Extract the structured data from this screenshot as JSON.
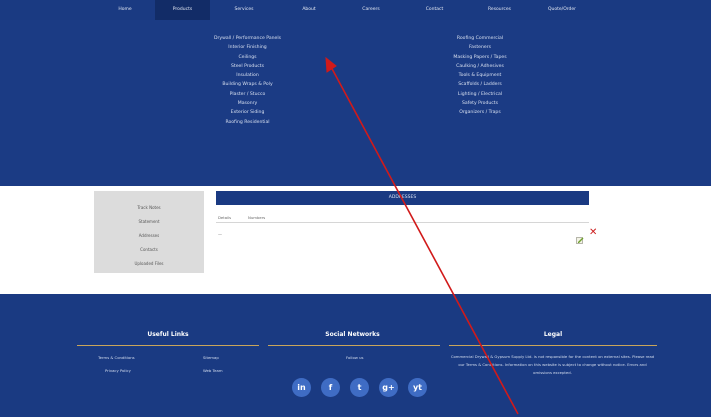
{
  "nav": {
    "items": [
      "Home",
      "Products",
      "Services",
      "About",
      "Careers",
      "Contact",
      "Resources",
      "Quote/Order"
    ],
    "active_index": 1
  },
  "dropdown": {
    "left_links": [
      "Drywall / Performance Panels",
      "Interior Finishing",
      "Ceilings",
      "Steel Products",
      "Insulation",
      "Building Wraps & Poly",
      "Plaster / Stucco",
      "Masonry",
      "Exterior Siding",
      "Roofing Residential"
    ],
    "right_links": [
      "Roofing Commercial",
      "Fasteners",
      "Masking Papers / Tapes",
      "Caulking / Adhesives",
      "Tools & Equipment",
      "Scaffolds / Ladders",
      "Lighting / Electrical",
      "Safety Products",
      "Organizers / Traps"
    ]
  },
  "side_menu": [
    "Track Notes",
    "Statement",
    "Addresses",
    "Contacts",
    "Uploaded Files"
  ],
  "panel": {
    "title": "ADDRESSES",
    "col_1": "Details",
    "col_2": "Numbers",
    "row_text": "—"
  },
  "footer": {
    "useful_links_title": "Useful Links",
    "social_title": "Social Networks",
    "legal_title": "Legal",
    "links": [
      "Terms & Conditions",
      "Sitemap",
      "Privacy Policy",
      "Web Team"
    ],
    "follow_text": "Follow us",
    "legal_text": "Commercial Drywall & Gypsum Supply Ltd. is not responsible for the content on external sites. Please read our Terms & Conditions. Information on this website is subject to change without notice. Errors and omissions excepted.",
    "social_icons": [
      "in",
      "f",
      "t",
      "g+",
      "yt"
    ]
  },
  "colors": {
    "nav_bg": "#1a3a82",
    "footer_bg": "#1a3a82",
    "accent_rule": "#c9a55a",
    "annotation": "#d11a1a",
    "delete": "#cc1d1d"
  }
}
